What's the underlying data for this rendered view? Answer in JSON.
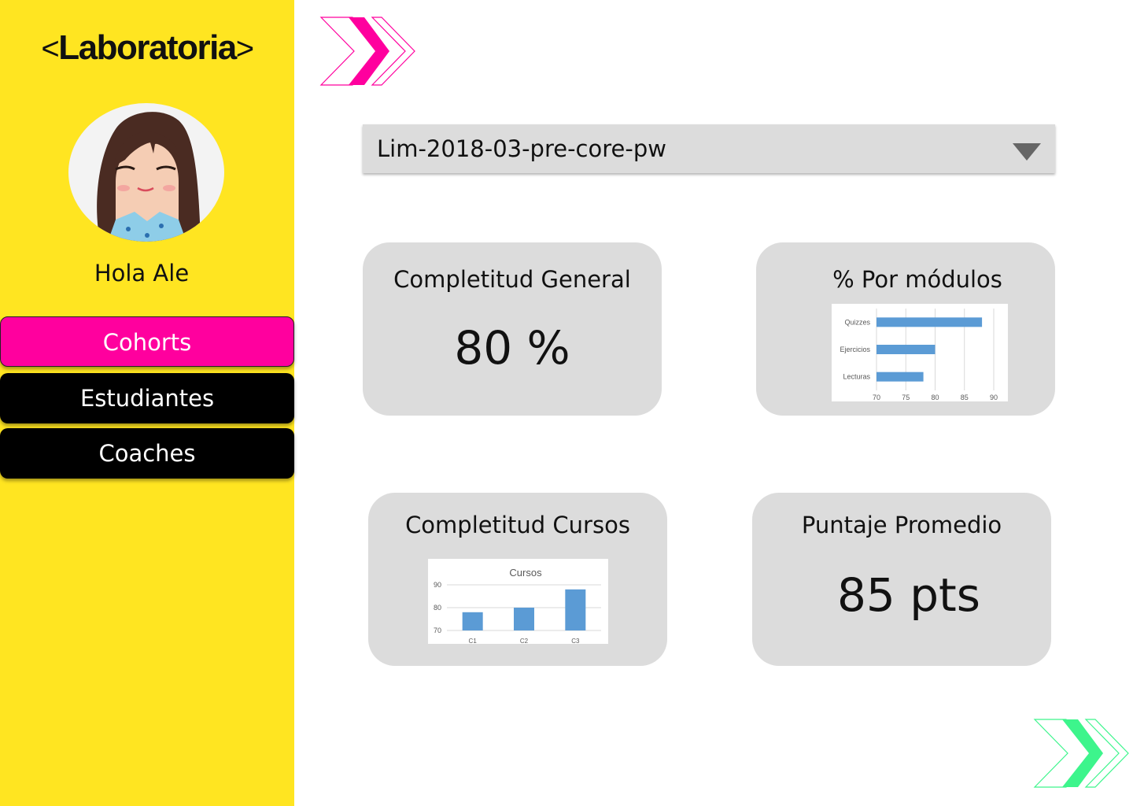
{
  "brand": {
    "name": "Laboratoria",
    "left_bracket": "<",
    "right_bracket": ">"
  },
  "sidebar": {
    "greeting": "Hola Ale",
    "nav": [
      {
        "label": "Cohorts",
        "active": true
      },
      {
        "label": "Estudiantes",
        "active": false
      },
      {
        "label": "Coaches",
        "active": false
      }
    ]
  },
  "cohort_select": {
    "value": "Lim-2018-03-pre-core-pw"
  },
  "cards": {
    "general": {
      "title": "Completitud General",
      "value": "80 %"
    },
    "modules": {
      "title": "% Por módulos"
    },
    "courses": {
      "title": "Completitud Cursos"
    },
    "score": {
      "title": "Puntaje Promedio",
      "value": "85 pts"
    }
  },
  "colors": {
    "sidebar": "#FFE521",
    "accent": "#FF009E",
    "nav_bg": "#000000",
    "card_bg": "#DCDCDC",
    "bar": "#5B9BD5",
    "deco_green": "#3DF58C"
  },
  "chart_data": [
    {
      "type": "bar",
      "orientation": "horizontal",
      "categories": [
        "Quizzes",
        "Ejercicios",
        "Lecturas"
      ],
      "values": [
        88,
        80,
        78
      ],
      "xlim": [
        70,
        90
      ],
      "xticks": [
        "70",
        "75",
        "80",
        "85",
        "90"
      ],
      "grid": true
    },
    {
      "type": "bar",
      "title": "Cursos",
      "categories": [
        "C1",
        "C2",
        "C3"
      ],
      "values": [
        78,
        80,
        88
      ],
      "ylim": [
        70,
        90
      ],
      "yticks": [
        "70",
        "80",
        "90"
      ],
      "grid": true
    }
  ]
}
